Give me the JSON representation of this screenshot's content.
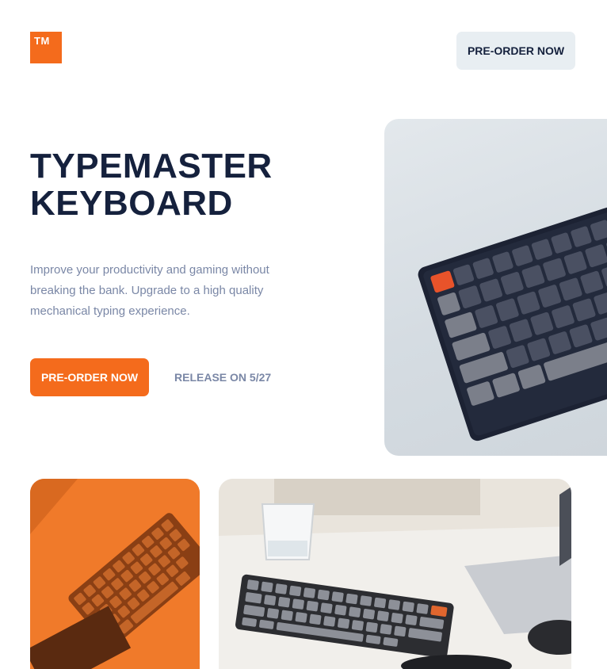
{
  "brand": {
    "logo_text": "TM",
    "accent": "#f46b1c",
    "navy": "#15213d",
    "muted": "#7a87a6"
  },
  "header": {
    "preorder_label": "PRE-ORDER NOW"
  },
  "hero": {
    "title_line1": "TYPEMASTER",
    "title_line2": "KEYBOARD",
    "description": "Improve your productivity and gaming without breaking the bank. Upgrade to a high quality mechanical typing experience.",
    "cta_label": "PRE-ORDER NOW",
    "release_text": "RELEASE ON 5/27"
  }
}
